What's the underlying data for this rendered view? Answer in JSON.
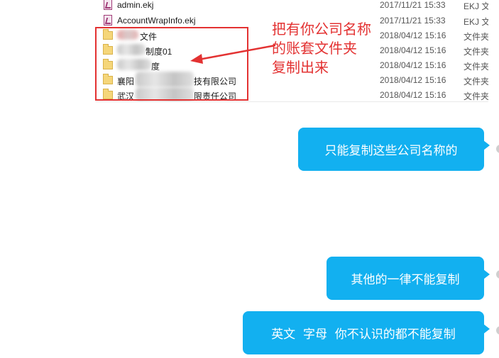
{
  "files": [
    {
      "name": "admin.ekj",
      "date": "2017/11/21 15:33",
      "type": "EKJ 文",
      "kind": "ekj"
    },
    {
      "name": "AccountWrapInfo.ekj",
      "date": "2017/11/21 15:33",
      "type": "EKJ 文",
      "kind": "ekj"
    },
    {
      "name": "文件",
      "date": "2018/04/12 15:16",
      "type": "文件夹",
      "kind": "folder"
    },
    {
      "name": "制度01",
      "date": "2018/04/12 15:16",
      "type": "文件夹",
      "kind": "folder"
    },
    {
      "name": "度",
      "date": "2018/04/12 15:16",
      "type": "文件夹",
      "kind": "folder"
    },
    {
      "name_start": "襄阳",
      "name_end": "技有限公司",
      "date": "2018/04/12 15:16",
      "type": "文件夹",
      "kind": "folder"
    },
    {
      "name_start": "武汉",
      "name_end": "限责任公司",
      "date": "2018/04/12 15:16",
      "type": "文件夹",
      "kind": "folder"
    }
  ],
  "annotation": {
    "lines": [
      "把有你公司名称",
      "的账套文件夹",
      "复制出来"
    ],
    "color": "#e33232"
  },
  "messages": [
    {
      "text": "只能复制这些公司名称的"
    },
    {
      "text": "其他的一律不能复制"
    },
    {
      "text": "英文  字母  你不认识的都不能复制"
    }
  ],
  "colors": {
    "bubble": "#12b0f0",
    "annotation": "#e33232"
  }
}
